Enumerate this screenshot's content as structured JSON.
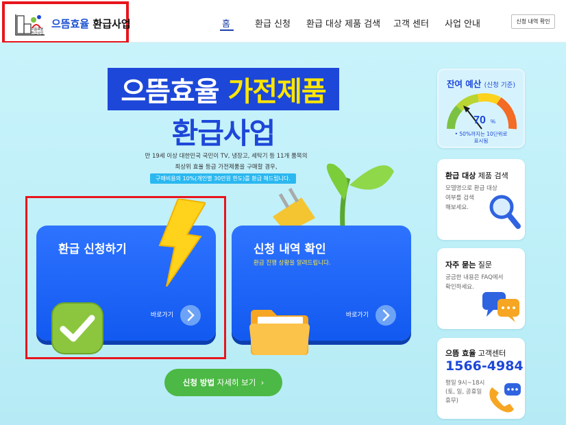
{
  "header": {
    "logo_title_blue": "으뜸효율",
    "logo_title_black": " 환급사업",
    "logo_sub": "으뜸효율 환급사업",
    "nav": [
      {
        "label": "홈",
        "active": true
      },
      {
        "label": "환급 신청",
        "active": false
      },
      {
        "label": "환급 대상 제품 검색",
        "active": false
      },
      {
        "label": "고객 센터",
        "active": false
      },
      {
        "label": "사업 안내",
        "active": false
      }
    ],
    "history_button": "신청 내역 확인"
  },
  "hero": {
    "title_white": "으뜸효율 ",
    "title_yellow": "가전제품",
    "title_line2": "환급사업",
    "description_line1": "만 19세 이상 대한민국 국민이 TV, 냉장고, 세탁기 등 11개 품목의",
    "description_line2": "최상위 효율 등급 가전제품을 구매할 경우,",
    "description_highlight": "구매비용의 10%(개인별 30만원 한도)를 환급 해드립니다."
  },
  "cards": {
    "apply": {
      "title": "환급 신청하기",
      "go_label": "바로가기"
    },
    "history": {
      "title": "신청 내역 확인",
      "subtitle": "환급 진행 상황을 알려드립니다.",
      "go_label": "바로가기"
    }
  },
  "detail_button": {
    "bold": "신청 방법",
    "rest": " 자세히 보기",
    "chevron": "›"
  },
  "budget": {
    "title": "잔여 예산",
    "title_small": "(신청 기준)",
    "value": 70,
    "percent_text": "70",
    "percent_unit": "%",
    "note_line1": "• 50%까지는 10단위로",
    "note_line2": "표시됨"
  },
  "search_panel": {
    "title_bold": "환급 대상",
    "title_rest": " 제품 검색",
    "desc_line1": "모델명으로 환급 대상",
    "desc_line2": "여부를 검색",
    "desc_line3": "해보세요."
  },
  "faq_panel": {
    "title_bold": "자주 묻는",
    "title_rest": " 질문",
    "desc_line1": "궁금한 내용은 FAQ에서",
    "desc_line2": "확인하세요."
  },
  "center_panel": {
    "title_bold": "으뜸 효율",
    "title_rest": " 고객센터",
    "phone": "1566-4984",
    "hours_line1": "평일 9시~18시",
    "hours_line2": "(토, 일, 공휴일",
    "hours_line3": "휴무)"
  },
  "colors": {
    "brand_blue": "#1d47d8",
    "highlight_yellow": "#ffe600",
    "green_button": "#4cb845",
    "hero_bg": "#c9f3fb",
    "annotation_red": "#e8141b"
  }
}
